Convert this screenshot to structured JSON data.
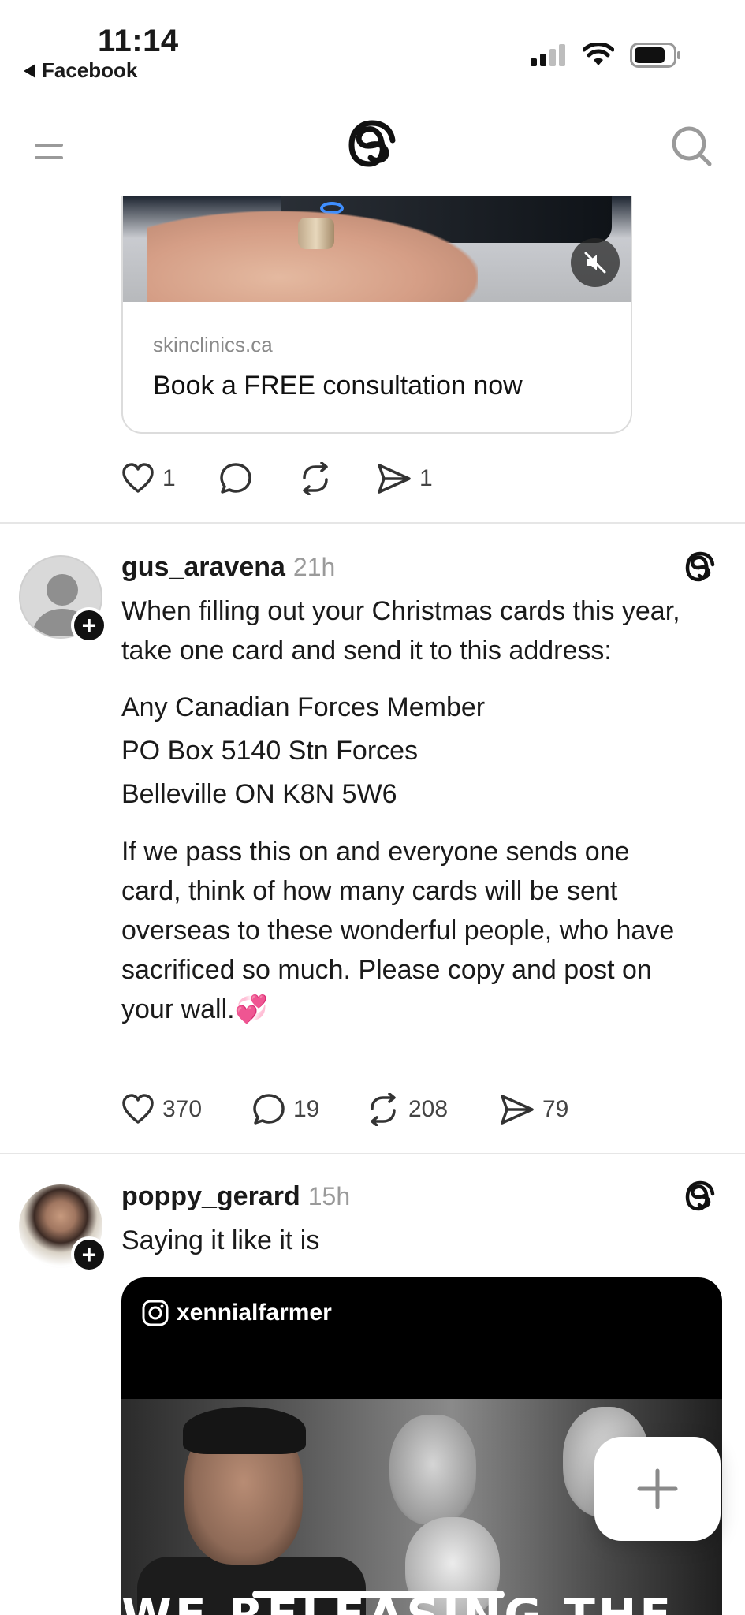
{
  "status_bar": {
    "time": "11:14",
    "back_app": "Facebook"
  },
  "ad_post": {
    "domain": "skinclinics.ca",
    "cta": "Book a FREE consultation now",
    "likes": "1",
    "shares": "1"
  },
  "posts": [
    {
      "username": "gus_aravena",
      "time": "21h",
      "paragraphs": [
        "When filling out your Christmas cards this year, take one card and send it to this address:",
        "If we pass this on and everyone sends one card, think of how many cards will be sent overseas to these wonderful people, who have sacrificed so much. Please copy and post on your wall.💞"
      ],
      "address_lines": [
        "Any Canadian Forces Member",
        "PO Box 5140 Stn Forces",
        "Belleville ON K8N 5W6"
      ],
      "likes": "370",
      "replies": "19",
      "reposts": "208",
      "shares": "79"
    },
    {
      "username": "poppy_gerard",
      "time": "15h",
      "text": "Saying it like it is",
      "embed_handle": "xennialfarmer",
      "embed_caption": "WE RELEASING THE EPSTEIN"
    }
  ],
  "colors": {
    "text": "#1a1a1a",
    "muted": "#9a9a9a",
    "divider": "#e6e6e6",
    "icon": "#444444"
  }
}
